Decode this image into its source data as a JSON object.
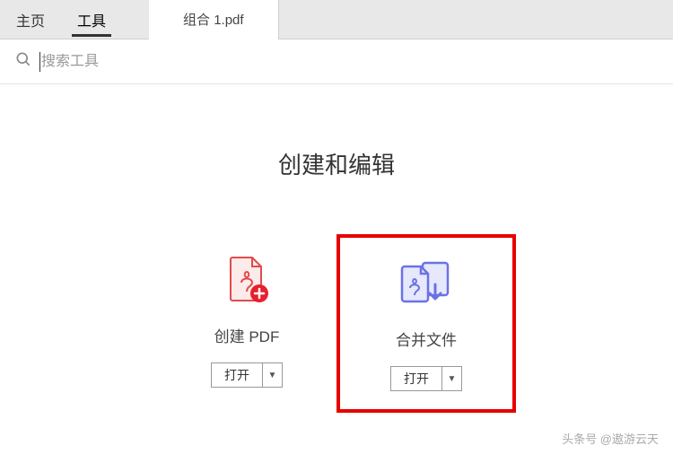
{
  "tabs": {
    "home": "主页",
    "tools": "工具",
    "document": "组合 1.pdf"
  },
  "search": {
    "placeholder": "搜索工具"
  },
  "section": {
    "title": "创建和编辑"
  },
  "tools": {
    "create_pdf": {
      "label": "创建 PDF",
      "open": "打开"
    },
    "combine": {
      "label": "合并文件",
      "open": "打开"
    }
  },
  "watermark": "头条号 @遨游云天"
}
